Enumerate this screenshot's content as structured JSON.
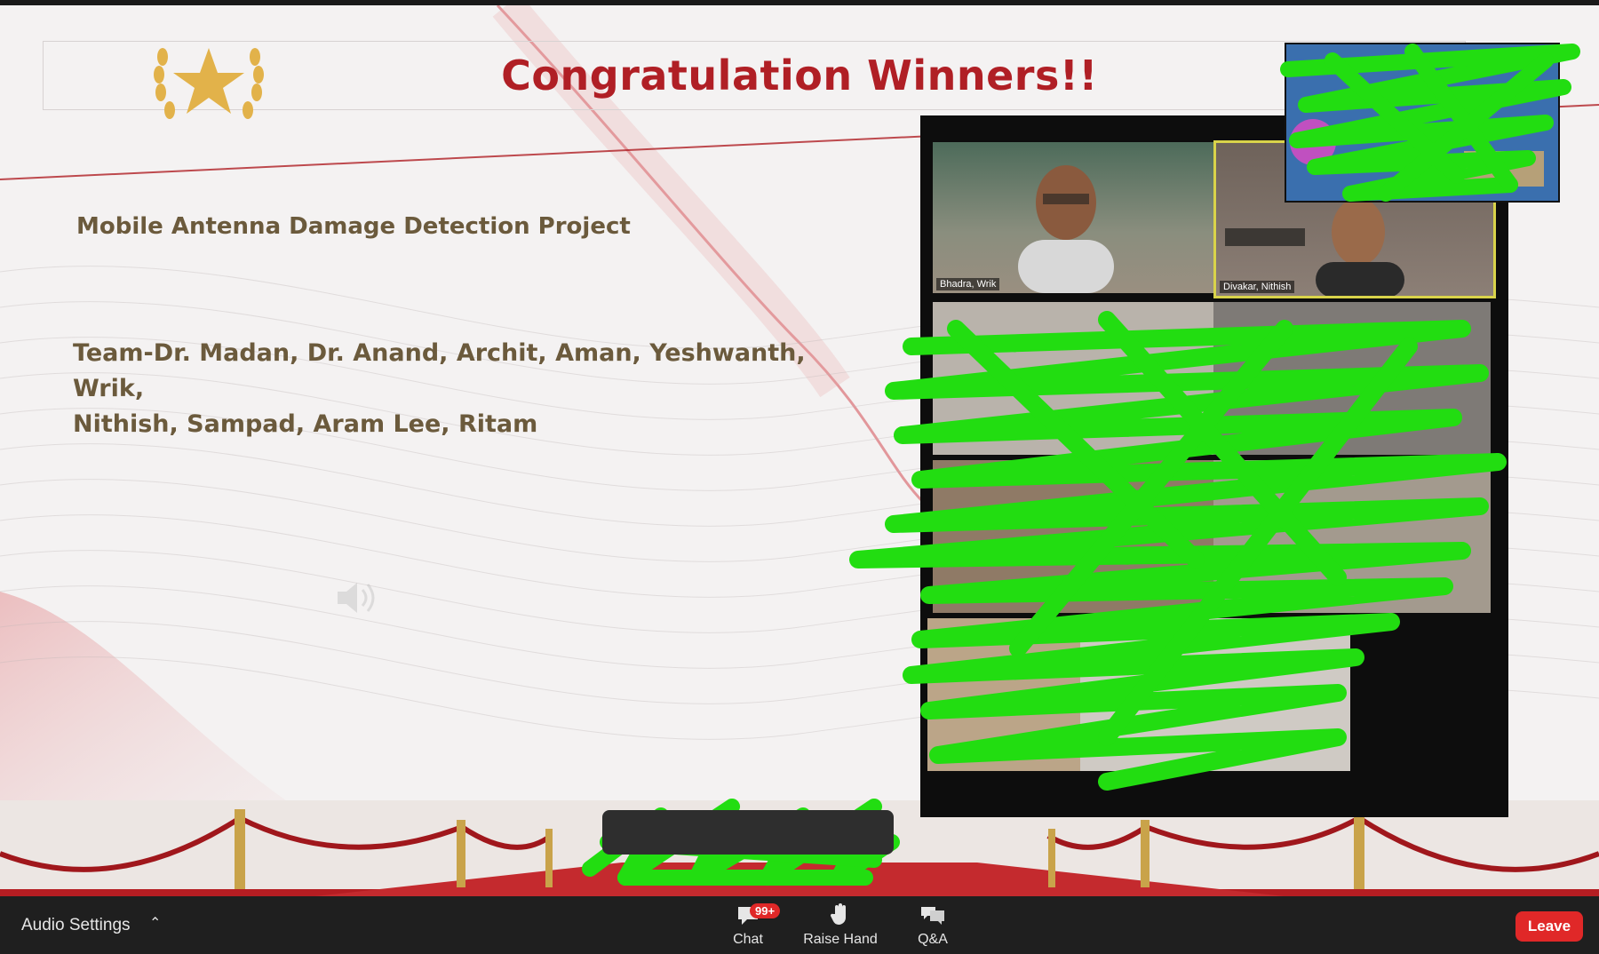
{
  "slide": {
    "title": "Congratulation Winners!!",
    "project": "Mobile Antenna Damage Detection Project",
    "team_line1": "Team-Dr. Madan, Dr. Anand, Archit, Aman, Yeshwanth, Wrik,",
    "team_line2": "Nithish, Sampad, Aram Lee, Ritam"
  },
  "gallery": {
    "tiles": [
      {
        "name": "Bhadra, Wrik"
      },
      {
        "name": "Divakar, Nithish"
      }
    ]
  },
  "toolbar": {
    "audio_settings": "Audio Settings",
    "chat_label": "Chat",
    "chat_badge": "99+",
    "raise_hand_label": "Raise Hand",
    "qa_label": "Q&A",
    "leave_label": "Leave"
  },
  "colors": {
    "title_red": "#b01f25",
    "body_text": "#6b5a3c",
    "scribble": "#22dd11",
    "leave": "#e02828"
  }
}
